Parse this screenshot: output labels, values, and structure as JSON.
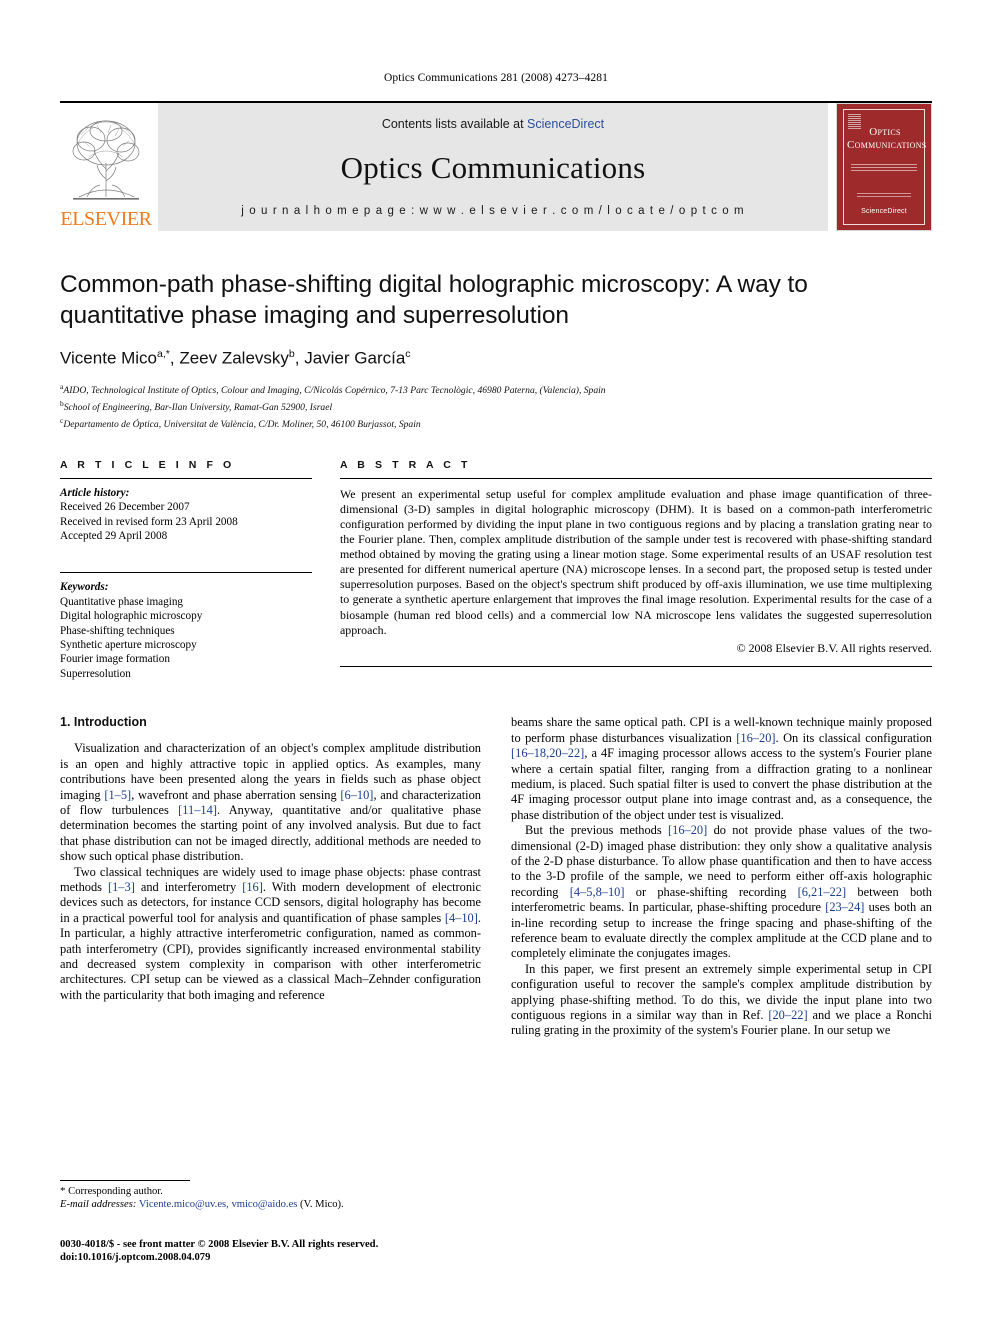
{
  "running_head": "Optics Communications 281 (2008) 4273–4281",
  "masthead": {
    "publisher_name": "ELSEVIER",
    "contents_prefix": "Contents lists available at ",
    "contents_link": "ScienceDirect",
    "journal_title": "Optics Communications",
    "homepage": "j o u r n a l   h o m e p a g e :   w w w . e l s e v i e r . c o m / l o c a t e / o p t c o m",
    "cover_title": "Optics Communications",
    "cover_footer_brand": "ScienceDirect",
    "accent_orange": "#ef7b21",
    "cover_red": "#9e2a2b",
    "link_blue": "#2b4ea2"
  },
  "article": {
    "title": "Common-path phase-shifting digital holographic microscopy: A way to quantitative phase imaging and superresolution",
    "authors": "Vicente Mico a,*, Zeev Zalevsky b, Javier García c",
    "author_list": [
      {
        "name": "Vicente Mico",
        "marks": "a,*"
      },
      {
        "name": "Zeev Zalevsky",
        "marks": "b"
      },
      {
        "name": "Javier García",
        "marks": "c"
      }
    ],
    "affiliations": [
      {
        "mark": "a",
        "text": "AIDO, Technological Institute of Optics, Colour and Imaging, C/Nicolás Copérnico, 7-13 Parc Tecnològic, 46980 Paterna, (Valencia), Spain"
      },
      {
        "mark": "b",
        "text": "School of Engineering, Bar-Ilan University, Ramat-Gan 52900, Israel"
      },
      {
        "mark": "c",
        "text": "Departamento de Óptica, Universitat de València, C/Dr. Moliner, 50, 46100 Burjassot, Spain"
      }
    ]
  },
  "article_info": {
    "heading": "A R T I C L E   I N F O",
    "history_label": "Article history:",
    "history": [
      "Received 26 December 2007",
      "Received in revised form 23 April 2008",
      "Accepted 29 April 2008"
    ],
    "keywords_label": "Keywords:",
    "keywords": [
      "Quantitative phase imaging",
      "Digital holographic microscopy",
      "Phase-shifting techniques",
      "Synthetic aperture microscopy",
      "Fourier image formation",
      "Superresolution"
    ]
  },
  "abstract": {
    "heading": "A B S T R A C T",
    "text": "We present an experimental setup useful for complex amplitude evaluation and phase image quantification of three-dimensional (3-D) samples in digital holographic microscopy (DHM). It is based on a common-path interferometric configuration performed by dividing the input plane in two contiguous regions and by placing a translation grating near to the Fourier plane. Then, complex amplitude distribution of the sample under test is recovered with phase-shifting standard method obtained by moving the grating using a linear motion stage. Some experimental results of an USAF resolution test are presented for different numerical aperture (NA) microscope lenses. In a second part, the proposed setup is tested under superresolution purposes. Based on the object's spectrum shift produced by off-axis illumination, we use time multiplexing to generate a synthetic aperture enlargement that improves the final image resolution. Experimental results for the case of a biosample (human red blood cells) and a commercial low NA microscope lens validates the suggested superresolution approach.",
    "copyright": "© 2008 Elsevier B.V. All rights reserved."
  },
  "body": {
    "section_number_title": "1. Introduction",
    "left_paragraphs": [
      "Visualization and characterization of an object's complex amplitude distribution is an open and highly attractive topic in applied optics. As examples, many contributions have been presented along the years in fields such as phase object imaging [1–5], wavefront and phase aberration sensing [6–10], and characterization of flow turbulences [11–14]. Anyway, quantitative and/or qualitative phase determination becomes the starting point of any involved analysis. But due to fact that phase distribution can not be imaged directly, additional methods are needed to show such optical phase distribution.",
      "Two classical techniques are widely used to image phase objects: phase contrast methods [1–3] and interferometry [16]. With modern development of electronic devices such as detectors, for instance CCD sensors, digital holography has become in a practical powerful tool for analysis and quantification of phase samples [4–10]. In particular, a highly attractive interferometric configuration, named as common-path interferometry (CPI), provides significantly increased environmental stability and decreased system complexity in comparison with other interferometric architectures. CPI setup can be viewed as a classical Mach–Zehnder configuration with the particularity that both imaging and reference"
    ],
    "right_paragraphs": [
      "beams share the same optical path. CPI is a well-known technique mainly proposed to perform phase disturbances visualization [16–20]. On its classical configuration [16–18,20–22], a 4F imaging processor allows access to the system's Fourier plane where a certain spatial filter, ranging from a diffraction grating to a nonlinear medium, is placed. Such spatial filter is used to convert the phase distribution at the 4F imaging processor output plane into image contrast and, as a consequence, the phase distribution of the object under test is visualized.",
      "But the previous methods [16–20] do not provide phase values of the two-dimensional (2-D) imaged phase distribution: they only show a qualitative analysis of the 2-D phase disturbance. To allow phase quantification and then to have access to the 3-D profile of the sample, we need to perform either off-axis holographic recording [4–5,8–10] or phase-shifting recording [6,21–22] between both interferometric beams. In particular, phase-shifting procedure [23–24] uses both an in-line recording setup to increase the fringe spacing and phase-shifting of the reference beam to evaluate directly the complex amplitude at the CCD plane and to completely eliminate the conjugates images.",
      "In this paper, we first present an extremely simple experimental setup in CPI configuration useful to recover the sample's complex amplitude distribution by applying phase-shifting method. To do this, we divide the input plane into two contiguous regions in a similar way than in Ref. [20–22] and we place a Ronchi ruling grating in the proximity of the system's Fourier plane. In our setup we"
    ]
  },
  "footnotes": {
    "corresponding_author": "Corresponding author.",
    "email_label": "E-mail addresses:",
    "emails": "Vicente.mico@uv.es, vmico@aido.es",
    "email_owner": "(V. Mico)."
  },
  "imprint": {
    "issn_line": "0030-4018/$ - see front matter © 2008 Elsevier B.V. All rights reserved.",
    "doi_line": "doi:10.1016/j.optcom.2008.04.079"
  }
}
